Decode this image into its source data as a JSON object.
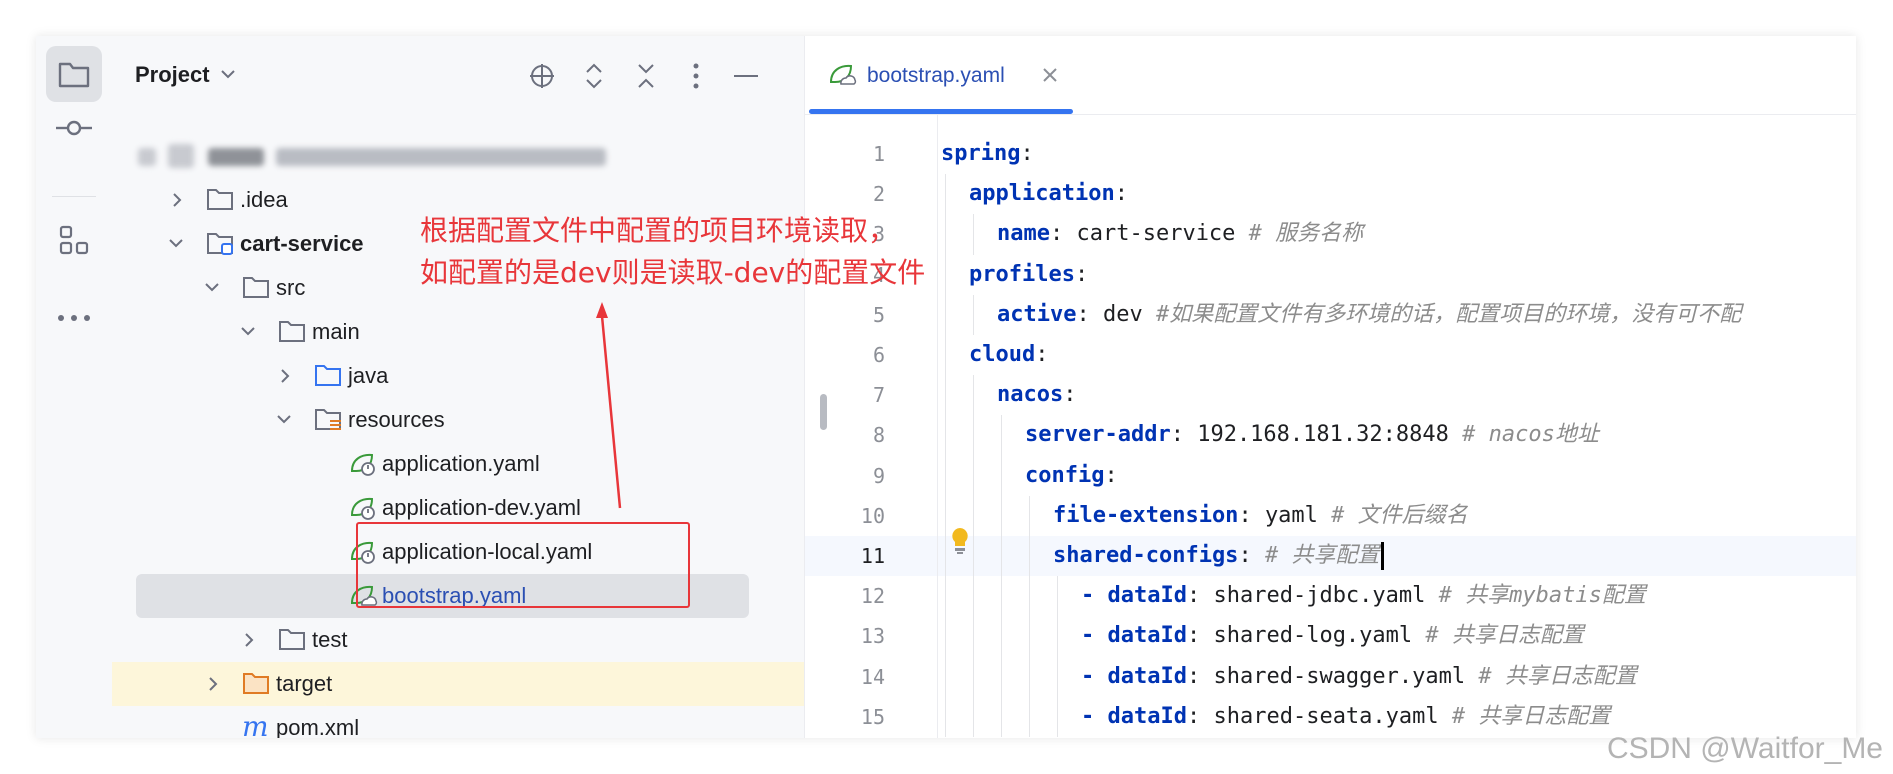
{
  "project_panel": {
    "title": "Project",
    "tree": [
      {
        "label": ".idea",
        "type": "folder",
        "expanded": false
      },
      {
        "label": "cart-service",
        "type": "module",
        "expanded": true
      },
      {
        "label": "src",
        "type": "folder",
        "expanded": true
      },
      {
        "label": "main",
        "type": "folder",
        "expanded": true
      },
      {
        "label": "java",
        "type": "source-folder",
        "expanded": false
      },
      {
        "label": "resources",
        "type": "resource-folder",
        "expanded": true
      },
      {
        "label": "application.yaml",
        "type": "spring-yaml"
      },
      {
        "label": "application-dev.yaml",
        "type": "spring-yaml"
      },
      {
        "label": "application-local.yaml",
        "type": "spring-yaml"
      },
      {
        "label": "bootstrap.yaml",
        "type": "spring-yaml-boot"
      },
      {
        "label": "test",
        "type": "folder",
        "expanded": false
      },
      {
        "label": "target",
        "type": "excluded-folder",
        "expanded": false
      },
      {
        "label": "pom.xml",
        "type": "maven"
      }
    ]
  },
  "editor": {
    "tab_label": "bootstrap.yaml",
    "current_line": 11,
    "lines": [
      {
        "n": "1",
        "key": "spring",
        "sep": ":",
        "value": "",
        "comment": ""
      },
      {
        "n": "2",
        "key": "application",
        "sep": ":",
        "value": "",
        "comment": ""
      },
      {
        "n": "3",
        "key": "name",
        "sep": ": ",
        "value": "cart-service",
        "comment": " # 服务名称"
      },
      {
        "n": "4",
        "key": "profiles",
        "sep": ":",
        "value": "",
        "comment": ""
      },
      {
        "n": "5",
        "key": "active",
        "sep": ": ",
        "value": "dev",
        "comment": " #如果配置文件有多环境的话，配置项目的环境，没有可不配"
      },
      {
        "n": "6",
        "key": "cloud",
        "sep": ":",
        "value": "",
        "comment": ""
      },
      {
        "n": "7",
        "key": "nacos",
        "sep": ":",
        "value": "",
        "comment": ""
      },
      {
        "n": "8",
        "key": "server-addr",
        "sep": ": ",
        "value": "192.168.181.32:8848",
        "comment": " # nacos地址"
      },
      {
        "n": "9",
        "key": "config",
        "sep": ":",
        "value": "",
        "comment": ""
      },
      {
        "n": "10",
        "key": "file-extension",
        "sep": ": ",
        "value": "yaml",
        "comment": " # 文件后缀名"
      },
      {
        "n": "11",
        "key": "shared-configs",
        "sep": ": ",
        "value": "",
        "comment": "# 共享配置"
      },
      {
        "n": "12",
        "dash": "- ",
        "key": "dataId",
        "sep": ": ",
        "value": "shared-jdbc.yaml",
        "comment": " # 共享mybatis配置"
      },
      {
        "n": "13",
        "dash": "- ",
        "key": "dataId",
        "sep": ": ",
        "value": "shared-log.yaml",
        "comment": " # 共享日志配置"
      },
      {
        "n": "14",
        "dash": "- ",
        "key": "dataId",
        "sep": ": ",
        "value": "shared-swagger.yaml",
        "comment": " # 共享日志配置"
      },
      {
        "n": "15",
        "dash": "- ",
        "key": "dataId",
        "sep": ": ",
        "value": "shared-seata.yaml",
        "comment": " # 共享日志配置"
      }
    ]
  },
  "annotation": {
    "line1": "根据配置文件中配置的项目环境读取，",
    "line2": "如配置的是dev则是读取-dev的配置文件"
  },
  "watermark": "CSDN @Waitfor_Me",
  "colors": {
    "annotation_red": "#e8363a",
    "keyword_blue": "#0033b3",
    "accent": "#3574f0",
    "spring_green": "#3a9a3a"
  }
}
